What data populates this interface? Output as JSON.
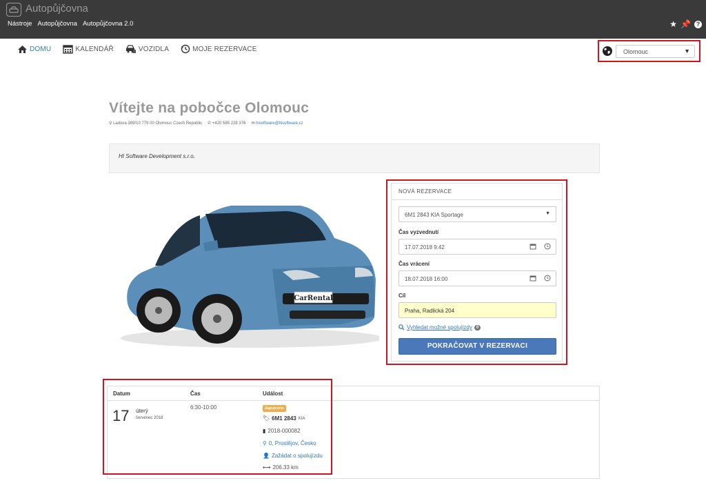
{
  "app": {
    "title": "Autopůjčovna",
    "menu": [
      "Nástroje",
      "Autopůjčovna",
      "Autopůjčovna 2.0"
    ],
    "icons": [
      "star-icon",
      "pin-icon",
      "help-icon"
    ]
  },
  "nav": {
    "items": [
      {
        "label": "DOMU",
        "icon": "home-icon",
        "active": true
      },
      {
        "label": "KALENDÁŘ",
        "icon": "calendar-icon",
        "active": false
      },
      {
        "label": "VOZIDLA",
        "icon": "vehicles-icon",
        "active": false
      },
      {
        "label": "MOJE REZERVACE",
        "icon": "history-icon",
        "active": false
      }
    ]
  },
  "branch": {
    "selected": "Olomouc"
  },
  "page": {
    "title": "Vítejte na pobočce Olomouc",
    "address": "Ladova 389/10 779 00 Olomouc Czech Republic",
    "phone": "+420 585 228 376",
    "email": "hisoftware@hisoftware.cz",
    "company": "HI Software Development s.r.o."
  },
  "car_image": {
    "plate_text": "CarRental"
  },
  "reservation": {
    "header": "NOVÁ REZERVACE",
    "vehicle": "6M1 2843 KIA Sportage",
    "pickup_label": "Čas vyzvednutí",
    "pickup_value": "17.07.2018 9:42",
    "return_label": "Čas vrácení",
    "return_value": "18.07.2018 16:00",
    "destination_label": "Cíl",
    "destination_value": "Praha, Radlická 204",
    "search_link": "Vyhledat možné spolujízdy",
    "search_count": "0",
    "continue_button": "POKRAČOVAT V REZERVACI"
  },
  "events": {
    "headers": [
      "Datum",
      "Čas",
      "Událost"
    ],
    "rows": [
      {
        "day": "17",
        "weekday": "úterý",
        "month_year": "červenec 2018",
        "time": "6:30-10:00",
        "status": "Zapujceno",
        "vehicle_plate": "6M1 2843",
        "vehicle_make": "KIA",
        "number": "2018-000082",
        "location": "0, Prostějov, Česko",
        "request_ride": "Zažádat o spolujízdu",
        "distance": "206.33 km"
      }
    ]
  },
  "colors": {
    "topbar": "#3a3a3a",
    "accent": "#337ab7",
    "button": "#4a78b8",
    "highlight": "#d0131f",
    "status_badge": "#f0ad4e"
  }
}
